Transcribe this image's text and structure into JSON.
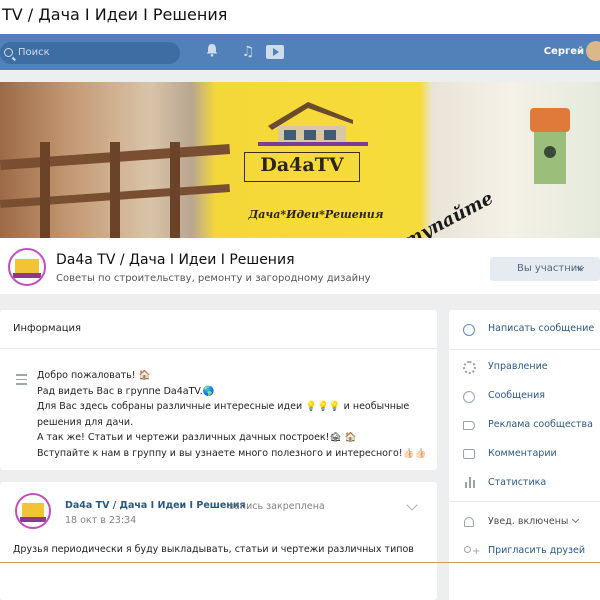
{
  "window": {
    "title": "TV / Дача I Идеи I Решения"
  },
  "header": {
    "search_placeholder": "Поиск",
    "user_name": "Сергей",
    "icons": [
      "search-icon",
      "bell-icon",
      "music-icon",
      "video-icon"
    ]
  },
  "cover": {
    "logo": "Da4aTV",
    "tagline": "Дача*Идеи*Решения",
    "cta": "вступайте"
  },
  "group": {
    "name": "Da4a TV / Дача I Идеи I Решения",
    "description": "Советы по строительству, ремонту и загородному дизайну",
    "member_button": "Вы участник"
  },
  "info": {
    "title": "Информация",
    "lines": [
      "Добро пожаловать! 🏠",
      "Рад видеть Вас в группе Da4aTV.🌎",
      "Для Вас здесь собраны различные интересные идеи 💡💡💡 и необычные",
      "решения для дачи.",
      "А так же! Статьи и чертежи различных дачных построек!🏚 🏠",
      "Вступайте к нам в группу и вы узнаете много полезного и интересного!👍🏻👍🏻👍🏻"
    ]
  },
  "post": {
    "author": "Da4a TV / Дача I Идеи I Решения",
    "pinned": "запись закреплена",
    "date": "18 окт в 23:34",
    "text": "Друзья периодически я буду выкладывать, статьи и чертежи различных типов"
  },
  "sidebar": {
    "write_message": "Написать сообщение",
    "items": [
      {
        "label": "Управление",
        "icon": "gear-icon"
      },
      {
        "label": "Сообщения",
        "icon": "message-icon"
      },
      {
        "label": "Реклама сообщества",
        "icon": "megaphone-icon"
      },
      {
        "label": "Комментарии",
        "icon": "comment-icon"
      },
      {
        "label": "Статистика",
        "icon": "stats-icon"
      }
    ],
    "notifications": "Увед. включены",
    "invite": "Пригласить друзей"
  },
  "colors": {
    "header_bg": "#5181b8",
    "link": "#2a5885",
    "page_bg": "#edeef0",
    "cover_yellow": "#f6dc3a"
  }
}
